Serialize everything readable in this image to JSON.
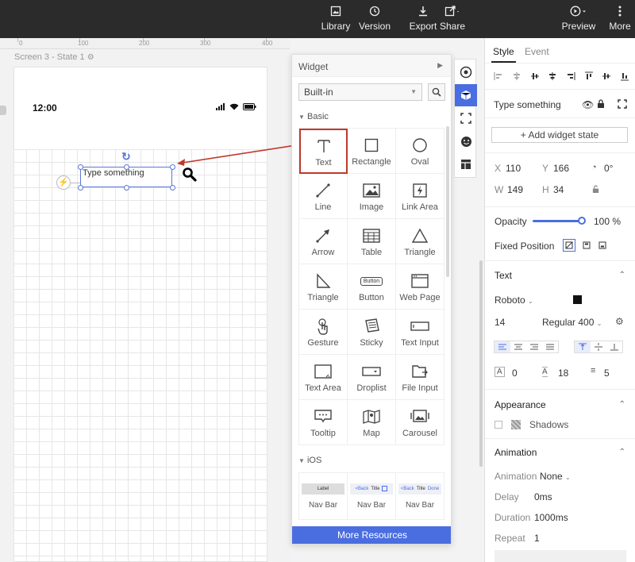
{
  "topbar": {
    "library": "Library",
    "version": "Version",
    "export": "Export",
    "share": "Share",
    "preview": "Preview",
    "more": "More"
  },
  "ruler": {
    "ticks": [
      "0",
      "100",
      "200",
      "300",
      "400"
    ]
  },
  "canvas": {
    "state_label": "Screen 3 - State 1",
    "time": "12:00",
    "textbox_text": "Type something"
  },
  "widget_panel": {
    "title": "Widget",
    "library_select": "Built-in",
    "section_basic": "Basic",
    "section_ios": "iOS",
    "widgets": [
      {
        "label": "Text",
        "icon": "text-icon"
      },
      {
        "label": "Rectangle",
        "icon": "rectangle-icon"
      },
      {
        "label": "Oval",
        "icon": "oval-icon"
      },
      {
        "label": "Line",
        "icon": "line-icon"
      },
      {
        "label": "Image",
        "icon": "image-icon"
      },
      {
        "label": "Link Area",
        "icon": "link-area-icon"
      },
      {
        "label": "Arrow",
        "icon": "arrow-icon"
      },
      {
        "label": "Table",
        "icon": "table-icon"
      },
      {
        "label": "Triangle",
        "icon": "triangle-icon"
      },
      {
        "label": "Triangle",
        "icon": "right-triangle-icon"
      },
      {
        "label": "Button",
        "icon": "button-icon"
      },
      {
        "label": "Web Page",
        "icon": "web-page-icon"
      },
      {
        "label": "Gesture",
        "icon": "gesture-icon"
      },
      {
        "label": "Sticky",
        "icon": "sticky-icon"
      },
      {
        "label": "Text Input",
        "icon": "text-input-icon"
      },
      {
        "label": "Text Area",
        "icon": "text-area-icon"
      },
      {
        "label": "Droplist",
        "icon": "droplist-icon"
      },
      {
        "label": "File Input",
        "icon": "file-input-icon"
      },
      {
        "label": "Tooltip",
        "icon": "tooltip-icon"
      },
      {
        "label": "Map",
        "icon": "map-icon"
      },
      {
        "label": "Carousel",
        "icon": "carousel-icon"
      }
    ],
    "button_icon_text": "Button",
    "ios_items": [
      {
        "preview": "Label",
        "name": "Nav Bar"
      },
      {
        "preview_back": "<Back",
        "preview_title": "Title",
        "name": "Nav Bar"
      },
      {
        "preview_back": "<Back",
        "preview_title": "Title",
        "preview_done": "Done",
        "name": "Nav Bar"
      }
    ],
    "more_resources": "More Resources"
  },
  "right_panel": {
    "tab_style": "Style",
    "tab_event": "Event",
    "widget_name": "Type something",
    "add_state": "+ Add widget state",
    "x_label": "X",
    "x_value": "110",
    "y_label": "Y",
    "y_value": "166",
    "rotation": "0°",
    "w_label": "W",
    "w_value": "149",
    "h_label": "H",
    "h_value": "34",
    "opacity_label": "Opacity",
    "opacity_value": "100 %",
    "fixed_position_label": "Fixed Position",
    "text_section": "Text",
    "font_family": "Roboto",
    "font_size": "14",
    "font_weight": "Regular 400",
    "letter_spacing": "0",
    "line_height": "18",
    "paragraph_spacing": "5",
    "appearance_section": "Appearance",
    "shadows_label": "Shadows",
    "animation_section": "Animation",
    "animation_label": "Animation",
    "animation_value": "None",
    "delay_label": "Delay",
    "delay_value": "0ms",
    "duration_label": "Duration",
    "duration_value": "1000ms",
    "repeat_label": "Repeat",
    "repeat_value": "1",
    "text_color": "#111111"
  },
  "colors": {
    "accent": "#4a6ee0",
    "highlight": "#c0392b",
    "topbar": "#2b2b2b"
  }
}
